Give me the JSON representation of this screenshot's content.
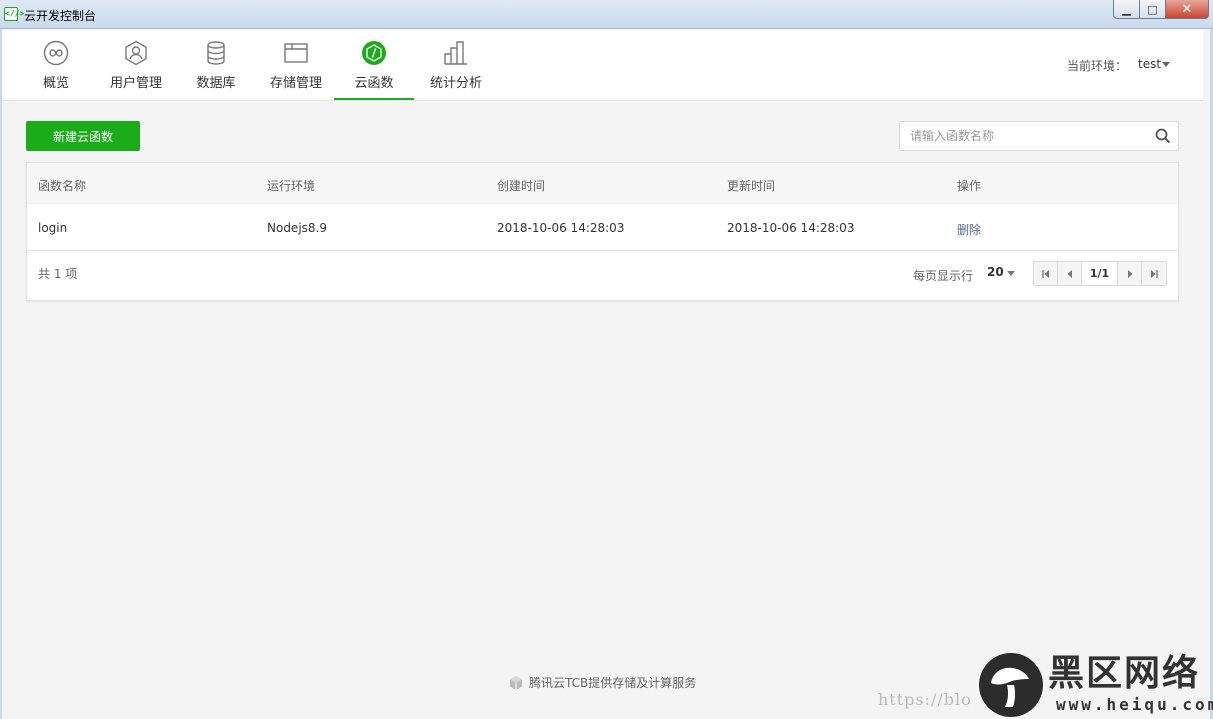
{
  "window": {
    "title": "云开发控制台",
    "app_icon": "<//>",
    "controls": {
      "minimize": "▁",
      "maximize": "□",
      "close": "✕"
    }
  },
  "nav": {
    "items": [
      {
        "label": "概览",
        "icon": "infinity-icon"
      },
      {
        "label": "用户管理",
        "icon": "user-icon"
      },
      {
        "label": "数据库",
        "icon": "database-icon"
      },
      {
        "label": "存储管理",
        "icon": "folder-icon"
      },
      {
        "label": "云函数",
        "icon": "cloud-function-icon",
        "active": true
      },
      {
        "label": "统计分析",
        "icon": "bar-chart-icon"
      }
    ],
    "env_label": "当前环境：",
    "env_value": "test"
  },
  "toolbar": {
    "new_label": "新建云函数",
    "search_placeholder": "请输入函数名称"
  },
  "table": {
    "headers": [
      "函数名称",
      "运行环境",
      "创建时间",
      "更新时间",
      "操作"
    ],
    "rows": [
      {
        "name": "login",
        "runtime": "Nodejs8.9",
        "created": "2018-10-06 14:28:03",
        "updated": "2018-10-06 14:28:03",
        "action": "删除"
      }
    ],
    "total": "共 1 项",
    "per_page_label": "每页显示行",
    "per_page_value": "20",
    "page": "1/1"
  },
  "footer": {
    "text": "腾讯云TCB提供存储及计算服务"
  },
  "watermark": {
    "url": "https://blo",
    "cn": "黑区网络",
    "site": "www.heiqu.com"
  },
  "colors": {
    "accent": "#1aad19",
    "link": "#576b95"
  }
}
